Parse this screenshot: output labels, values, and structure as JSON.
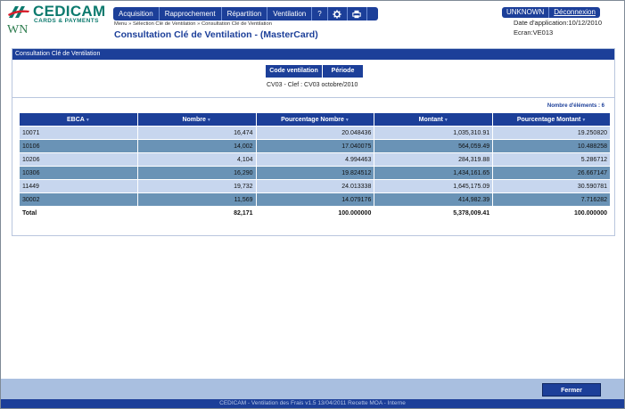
{
  "brand": {
    "name": "CEDICAM",
    "tagline": "CARDS & PAYMENTS",
    "initials": "WN"
  },
  "menu": {
    "items": [
      {
        "label": "Acquisition"
      },
      {
        "label": "Rapprochement"
      },
      {
        "label": "Répartition"
      },
      {
        "label": "Ventilation"
      },
      {
        "label": "?"
      }
    ],
    "settings_icon": "gear-icon",
    "print_icon": "printer-icon"
  },
  "breadcrumb": "Menu » Sélection Clé de Ventilation » Consultation Clé de Ventilation",
  "page_title": "Consultation Clé de Ventilation - (MasterCard)",
  "user": {
    "name": "UNKNOWN",
    "logout": "Déconnexion"
  },
  "app_date": "Date d'application:10/12/2010",
  "screen": "Ecran:VE013",
  "panel": {
    "title": "Consultation Clé de Ventilation",
    "criteria": {
      "col1": "Code ventilation",
      "col2": "Période",
      "value": "CV03 - Clef : CV03  octobre/2010"
    },
    "count_label": "Nombre d'éléments : 6"
  },
  "table": {
    "headers": [
      "EBCA",
      "Nombre",
      "Pourcentage Nombre",
      "Montant",
      "Pourcentage Montant"
    ],
    "rows": [
      [
        "10071",
        "16,474",
        "20.048436",
        "1,035,310.91",
        "19.250820"
      ],
      [
        "10106",
        "14,002",
        "17.040075",
        "564,059.49",
        "10.488258"
      ],
      [
        "10206",
        "4,104",
        "4.994463",
        "284,319.88",
        "5.286712"
      ],
      [
        "10306",
        "16,290",
        "19.824512",
        "1,434,161.65",
        "26.667147"
      ],
      [
        "11449",
        "19,732",
        "24.013338",
        "1,645,175.09",
        "30.590781"
      ],
      [
        "30002",
        "11,569",
        "14.079176",
        "414,982.39",
        "7.716282"
      ]
    ],
    "total": [
      "Total",
      "82,171",
      "100.000000",
      "5,378,009.41",
      "100.000000"
    ]
  },
  "close_button": "Fermer",
  "status_bar": "CEDICAM - Ventilation des Frais v1.5 13/04/2011 Recette MOA - Interne",
  "colors": {
    "primary": "#1c3f99",
    "row_light": "#c7d6ee",
    "row_dark": "#6a93b6",
    "brand_green": "#0c7a6e"
  }
}
